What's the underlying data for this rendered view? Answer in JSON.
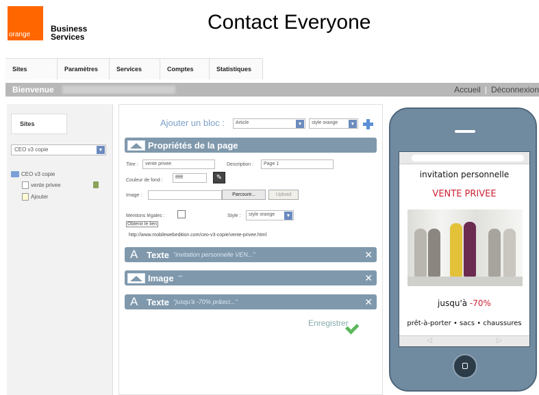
{
  "header": {
    "logo_text": "orange",
    "brand_line1": "Business",
    "brand_line2": "Services",
    "app_title": "Contact Everyone"
  },
  "nav": {
    "items": [
      "Sites",
      "Paramètres",
      "Services",
      "Comptes",
      "Statistiques"
    ]
  },
  "welcome_bar": {
    "welcome": "Bienvenue",
    "links": {
      "home": "Accueil",
      "separator": "|",
      "logout": "Déconnexion"
    }
  },
  "sidebar": {
    "sites_button": "Sites",
    "site_select_value": "CEO v3 copie",
    "tree": {
      "root": "CEO v3 copie",
      "children": [
        "vente privee",
        "Ajouter"
      ]
    }
  },
  "editor": {
    "add_block_label": "Ajouter un bloc :",
    "block_type_value": "Article",
    "block_style_value": "style orange",
    "page_props_title": "Propriétés de la page",
    "form": {
      "title_label": "Titre :",
      "title_value": "vente privee",
      "description_label": "Description :",
      "description_value": "Page 1",
      "bg_color_label": "Couleur de fond :",
      "bg_color_value": "ffffff",
      "image_label": "Image :",
      "image_value": "",
      "browse_button": "Parcourir...",
      "upload_button": "Upload",
      "legal_label": "Mentions légales :",
      "style_label": "Style :",
      "style_value": "style orange",
      "get_link": "Obtenir le lien",
      "url": "http://www.mobilewebedition.com/ceo-v3-copie/vente-privee.html"
    },
    "blocks": [
      {
        "icon_letter": "A",
        "type": "Texte",
        "preview": "\"invitation personnelle VEN...\""
      },
      {
        "icon_letter": "",
        "type": "Image",
        "preview": "\"\""
      },
      {
        "icon_letter": "A",
        "type": "Texte",
        "preview": "\"jusqu'à -70% pr&eci...\""
      }
    ],
    "close_glyph": "✕",
    "save_label": "Enregistrer"
  },
  "phone": {
    "line1": "invitation personnelle",
    "line2": "VENTE PRIVEE",
    "line3_prefix": "jusqu'à ",
    "line3_highlight": "-70%",
    "line4": "prêt-à-porter • sacs • chaussures",
    "nav_prev": "◁",
    "nav_next": "▷"
  },
  "colors": {
    "orange": "#ff6600",
    "bar": "#7f98ac",
    "phone_body": "#708aa0",
    "promo_red": "#cc2233",
    "save_green": "#5cb85c"
  },
  "icons": {
    "add_block": "plus-icon",
    "close": "close-icon",
    "save": "check-icon",
    "color_picker": "eyedropper-icon",
    "delete_page": "trash-icon"
  }
}
